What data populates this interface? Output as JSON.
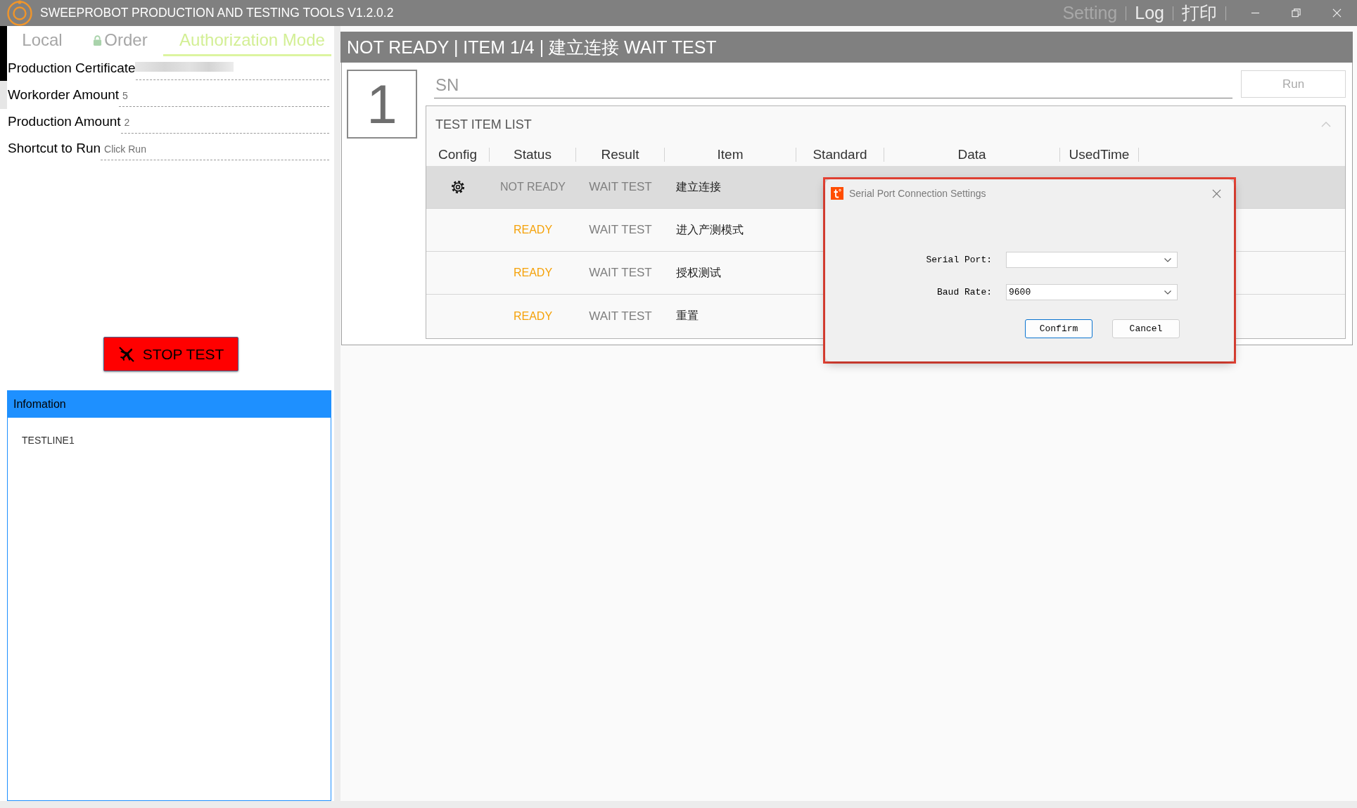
{
  "window": {
    "title": "SWEEPROBOT PRODUCTION AND TESTING TOOLS V1.2.0.2"
  },
  "title_bar_menu": [
    {
      "label": "Setting",
      "dimmed": true
    },
    {
      "label": "Log",
      "dimmed": false
    },
    {
      "label": "打印",
      "dimmed": false
    }
  ],
  "tabs": [
    {
      "label": "Local",
      "selected": false,
      "locked": false
    },
    {
      "label": "Order",
      "selected": false,
      "locked": true
    },
    {
      "label": "Authorization Mode",
      "selected": true,
      "locked": false
    }
  ],
  "fields": [
    {
      "label": "Production Certificate",
      "redacted": true
    },
    {
      "label": "Workorder Amount",
      "value": "5",
      "redacted": false
    },
    {
      "label": "Production Amount",
      "value": "2",
      "redacted": false
    },
    {
      "label": "Shortcut to Run",
      "value": "Click Run",
      "redacted": false
    }
  ],
  "stop_button": {
    "label": "STOP TEST"
  },
  "info_panel": {
    "title": "Infomation",
    "lines": [
      "TESTLINE1"
    ]
  },
  "status_header": "NOT READY | ITEM 1/4 | 建立连接 WAIT TEST",
  "slot_number": "1",
  "sn_field": {
    "placeholder": "SN"
  },
  "run_button": {
    "label": "Run",
    "disabled": true
  },
  "test_item_list": {
    "title": "TEST ITEM LIST",
    "expanded": true,
    "columns": [
      "Config",
      "Status",
      "Result",
      "Item",
      "Standard",
      "Data",
      "UsedTime"
    ],
    "rows": [
      {
        "config": true,
        "status": "NOT READY",
        "ready": false,
        "result": "WAIT TEST",
        "item": "建立连接",
        "selected": true
      },
      {
        "config": false,
        "status": "READY",
        "ready": true,
        "result": "WAIT TEST",
        "item": "进入产测模式",
        "selected": false
      },
      {
        "config": false,
        "status": "READY",
        "ready": true,
        "result": "WAIT TEST",
        "item": "授权测试",
        "selected": false
      },
      {
        "config": false,
        "status": "READY",
        "ready": true,
        "result": "WAIT TEST",
        "item": "重置",
        "selected": false
      }
    ]
  },
  "dialog": {
    "title": "Serial Port Connection Settings",
    "fields": [
      {
        "label": "Serial Port:"
      },
      {
        "label": "Baud Rate:",
        "value": "9600"
      }
    ],
    "buttons": [
      {
        "label": "Confirm",
        "default": true
      },
      {
        "label": "Cancel",
        "default": false
      }
    ]
  }
}
